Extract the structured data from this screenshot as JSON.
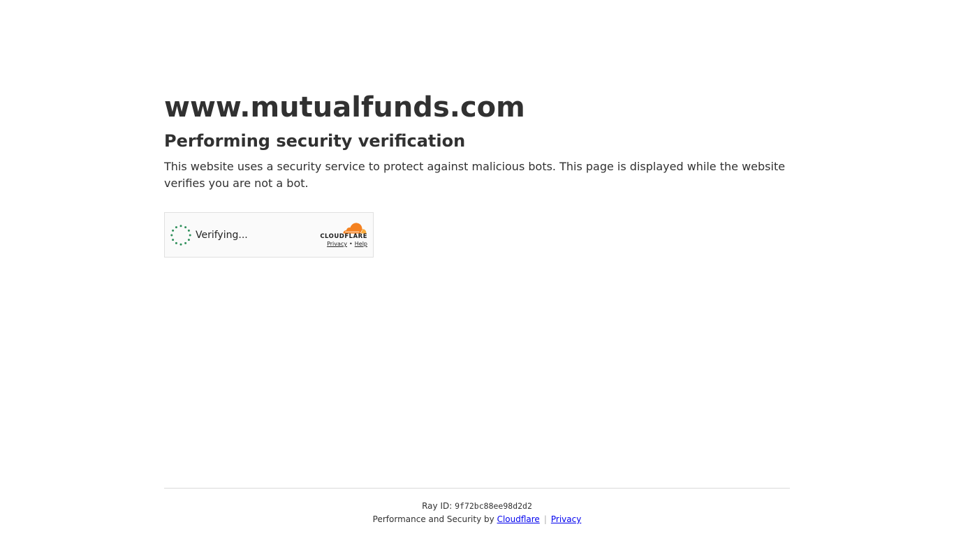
{
  "page": {
    "site_title": "www.mutualfunds.com",
    "heading": "Performing security verification",
    "description": "This website uses a security service to protect against malicious bots. This page is displayed while the website verifies you are not a bot."
  },
  "widget": {
    "status_text": "Verifying...",
    "spinner_icon": "loading-spinner-icon",
    "spinner_color": "#2f8f5b",
    "brand_text": "CLOUDFLARE",
    "brand_icon": "cloudflare-cloud-icon",
    "brand_color": "#f48120",
    "privacy_label": "Privacy",
    "separator": "•",
    "help_label": "Help"
  },
  "footer": {
    "ray_label": "Ray ID:",
    "ray_id": "9f72bc88ee98d2d2",
    "perf_prefix": "Performance and Security by",
    "cloudflare_link": "Cloudflare",
    "divider": "|",
    "privacy_link": "Privacy"
  }
}
